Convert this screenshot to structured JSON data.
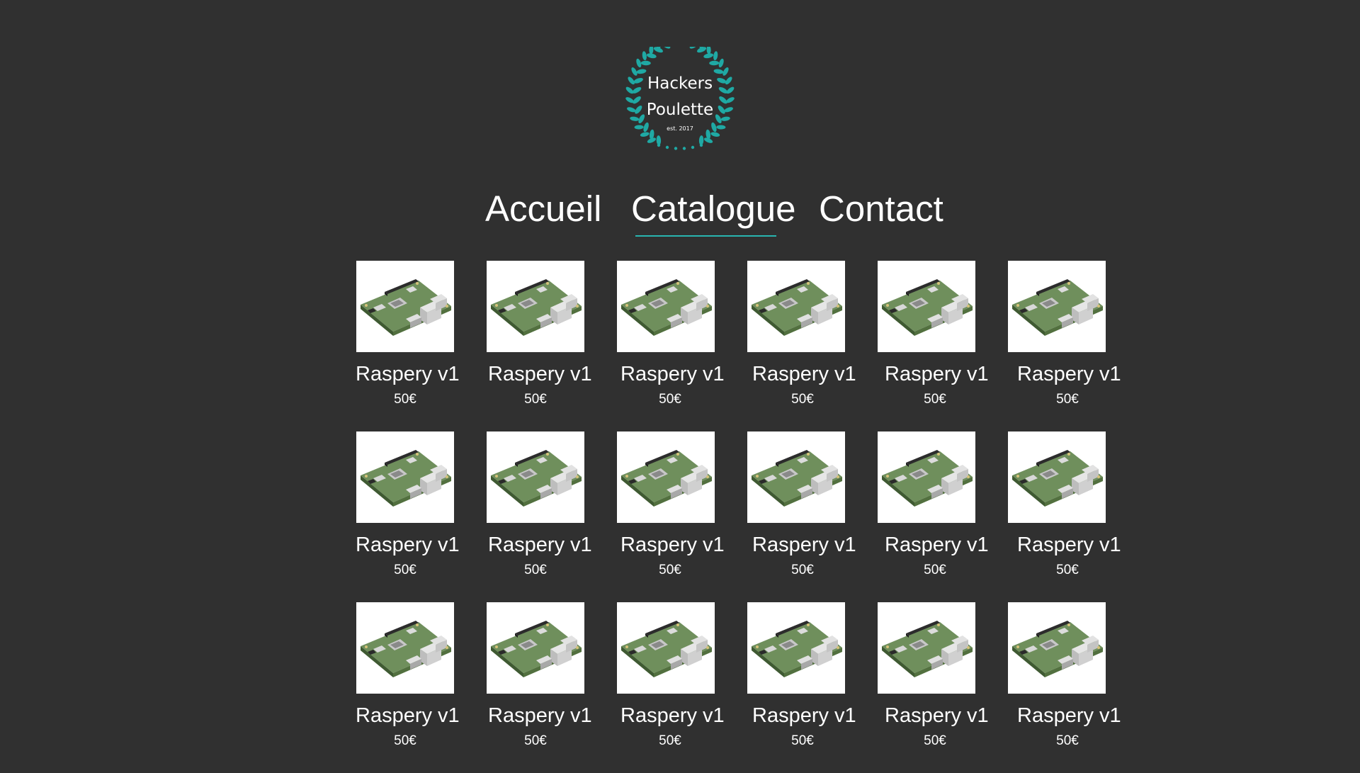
{
  "logo": {
    "line1": "Hackers",
    "line2": "Poulette",
    "tagline": "est. 2017",
    "icon": "laurel-wreath-icon",
    "color": "#1fa9a4"
  },
  "nav": {
    "items": [
      {
        "label": "Accueil",
        "active": false
      },
      {
        "label": "Catalogue",
        "active": true
      },
      {
        "label": "Contact",
        "active": false
      }
    ],
    "active_underline_color": "#29b5b0"
  },
  "products": {
    "image_icon": "raspberry-pi-board-icon",
    "rows": [
      [
        {
          "name": "Raspery v1",
          "price": "50€"
        },
        {
          "name": "Raspery v1",
          "price": "50€"
        },
        {
          "name": "Raspery v1",
          "price": "50€"
        },
        {
          "name": "Raspery v1",
          "price": "50€"
        },
        {
          "name": "Raspery v1",
          "price": "50€"
        },
        {
          "name": "Raspery v1",
          "price": "50€"
        }
      ],
      [
        {
          "name": "Raspery v1",
          "price": "50€"
        },
        {
          "name": "Raspery v1",
          "price": "50€"
        },
        {
          "name": "Raspery v1",
          "price": "50€"
        },
        {
          "name": "Raspery v1",
          "price": "50€"
        },
        {
          "name": "Raspery v1",
          "price": "50€"
        },
        {
          "name": "Raspery v1",
          "price": "50€"
        }
      ],
      [
        {
          "name": "Raspery v1",
          "price": "50€"
        },
        {
          "name": "Raspery v1",
          "price": "50€"
        },
        {
          "name": "Raspery v1",
          "price": "50€"
        },
        {
          "name": "Raspery v1",
          "price": "50€"
        },
        {
          "name": "Raspery v1",
          "price": "50€"
        },
        {
          "name": "Raspery v1",
          "price": "50€"
        }
      ]
    ]
  },
  "colors": {
    "background": "#303030",
    "text": "#ffffff",
    "accent": "#1fa9a4"
  }
}
